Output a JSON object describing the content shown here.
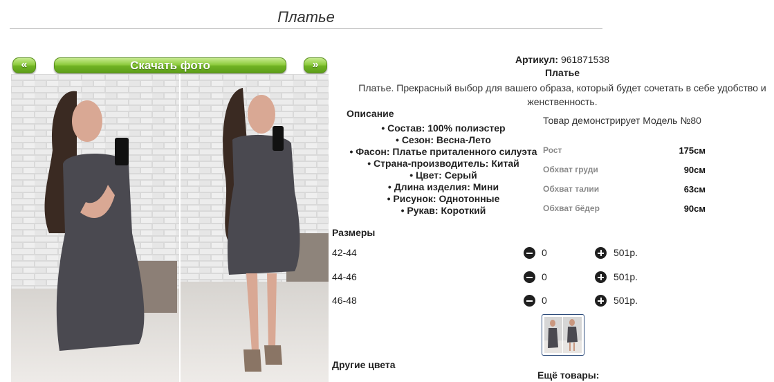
{
  "page": {
    "title": "Платье"
  },
  "gallery": {
    "prev_label": "«",
    "next_label": "»",
    "download_label": "Скачать фото"
  },
  "product": {
    "article_label": "Артикул:",
    "article_value": "961871538",
    "name": "Платье",
    "description_line1": "Платье. Прекрасный выбор для вашего образа, который будет сочетать в себе удобство и",
    "description_line2": "женственность."
  },
  "specs": {
    "heading": "Описание",
    "items": [
      "• Состав: 100% полиэстер",
      "• Сезон: Весна-Лето",
      "• Фасон: Платье приталенного силуэта",
      "• Страна-производитель: Китай",
      "• Цвет: Серый",
      "• Длина изделия: Мини",
      "• Рисунок: Однотонные",
      "• Рукав: Короткий"
    ]
  },
  "model": {
    "note": "Товар демонстрирует Модель №80",
    "measurements": [
      {
        "label": "Рост",
        "value": "175см"
      },
      {
        "label": "Обхват груди",
        "value": "90см"
      },
      {
        "label": "Обхват талии",
        "value": "63см"
      },
      {
        "label": "Обхват бёдер",
        "value": "90см"
      }
    ]
  },
  "sizes": {
    "heading": "Размеры",
    "rows": [
      {
        "size": "42-44",
        "qty": "0",
        "price": "501р."
      },
      {
        "size": "44-46",
        "qty": "0",
        "price": "501р."
      },
      {
        "size": "46-48",
        "qty": "0",
        "price": "501р."
      }
    ]
  },
  "footer": {
    "other_colors": "Другие цвета",
    "more_goods": "Ещё товары:"
  },
  "colors": {
    "button_green": "#6fb223",
    "dress_gray": "#4a4950",
    "thumb_border": "#2b4a7a"
  },
  "icons": {
    "minus": "minus-circle-icon",
    "plus": "plus-circle-icon"
  }
}
